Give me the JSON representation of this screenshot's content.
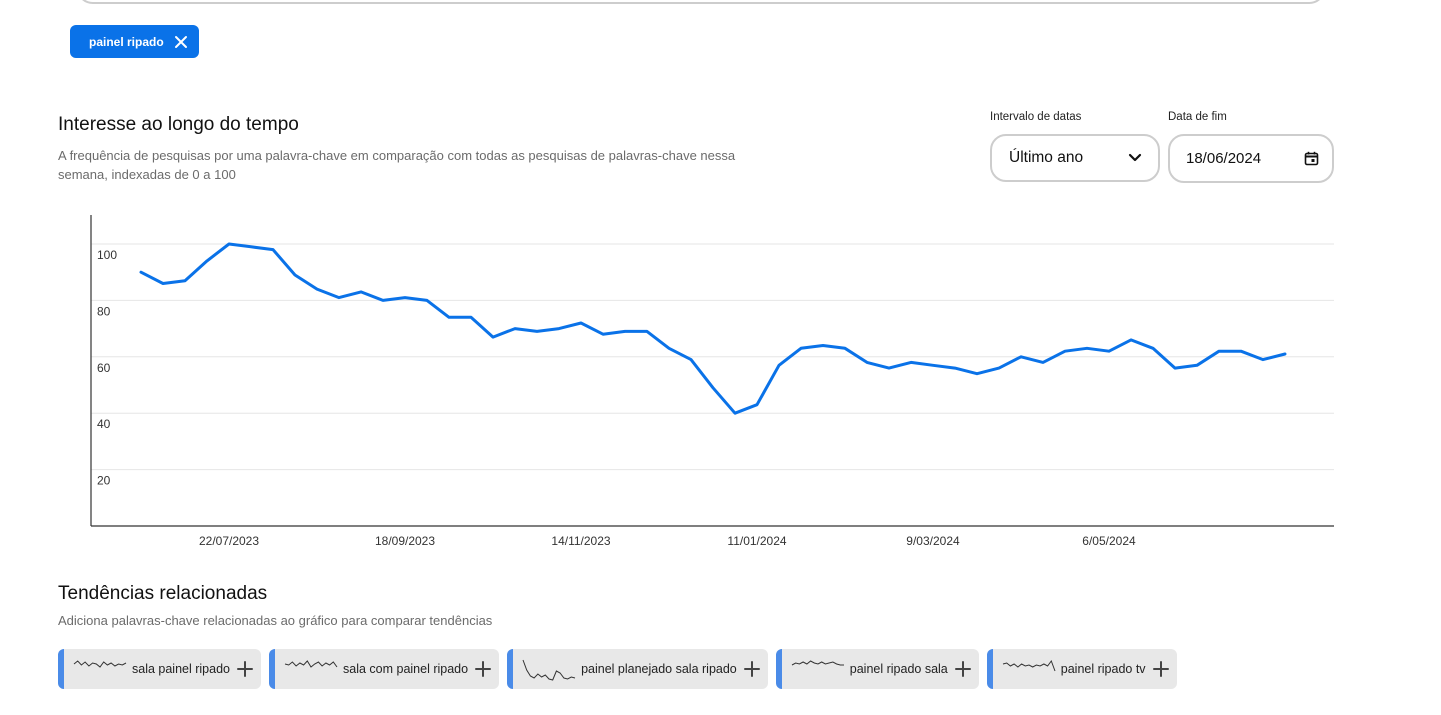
{
  "search_chip": {
    "label": "painel ripado",
    "icon": "close-icon"
  },
  "interest": {
    "title": "Interesse ao longo do tempo",
    "description_line1": "A frequência de pesquisas por uma palavra-chave em comparação com todas as pesquisas de palavras-chave nessa",
    "description_line2": "semana, indexadas de 0 a 100",
    "date_range_label": "Intervalo de datas",
    "date_range_value": "Último ano",
    "end_date_label": "Data de fim",
    "end_date_value": "18/06/2024"
  },
  "chart_data": {
    "type": "line",
    "color": "#0a72e8",
    "y_ticks": [
      100,
      80,
      60,
      40,
      20
    ],
    "ylim": [
      0,
      110
    ],
    "x_tick_labels": [
      "22/07/2023",
      "18/09/2023",
      "14/11/2023",
      "11/01/2024",
      "9/03/2024",
      "6/05/2024"
    ],
    "x_tick_index": [
      4,
      12,
      20,
      28,
      36,
      44
    ],
    "series": [
      {
        "values": [
          90,
          86,
          87,
          94,
          100,
          99,
          98,
          89,
          84,
          81,
          83,
          80,
          81,
          80,
          74,
          74,
          67,
          70,
          69,
          70,
          72,
          68,
          69,
          69,
          63,
          59,
          49,
          40,
          43,
          57,
          63,
          64,
          63,
          58,
          56,
          58,
          57,
          56,
          54,
          56,
          60,
          58,
          62,
          63,
          62,
          66,
          63,
          56,
          57,
          62,
          62,
          59,
          61
        ]
      }
    ]
  },
  "related": {
    "title": "Tendências relacionadas",
    "description": "Adiciona palavras-chave relacionadas ao gráfico para comparar tendências",
    "items": [
      {
        "label": "sala painel ripado",
        "spark": [
          6,
          3,
          7,
          4,
          8,
          5,
          6,
          9,
          4,
          7,
          5,
          8,
          6,
          7,
          5
        ]
      },
      {
        "label": "sala com painel ripado",
        "spark": [
          6,
          7,
          4,
          8,
          5,
          7,
          3,
          9,
          6,
          4,
          8,
          5,
          7,
          4,
          9
        ]
      },
      {
        "label": "painel planejado sala ripado",
        "spark": [
          2,
          12,
          18,
          20,
          16,
          19,
          17,
          21,
          22,
          13,
          15,
          20,
          21,
          19,
          20
        ]
      },
      {
        "label": "painel ripado sala",
        "spark": [
          7,
          5,
          6,
          4,
          6,
          3,
          5,
          6,
          4,
          6,
          5,
          4,
          6,
          7,
          7
        ]
      },
      {
        "label": "painel ripado tv",
        "spark": [
          6,
          5,
          8,
          6,
          9,
          6,
          8,
          7,
          9,
          7,
          8,
          6,
          8,
          3,
          13
        ]
      }
    ]
  }
}
